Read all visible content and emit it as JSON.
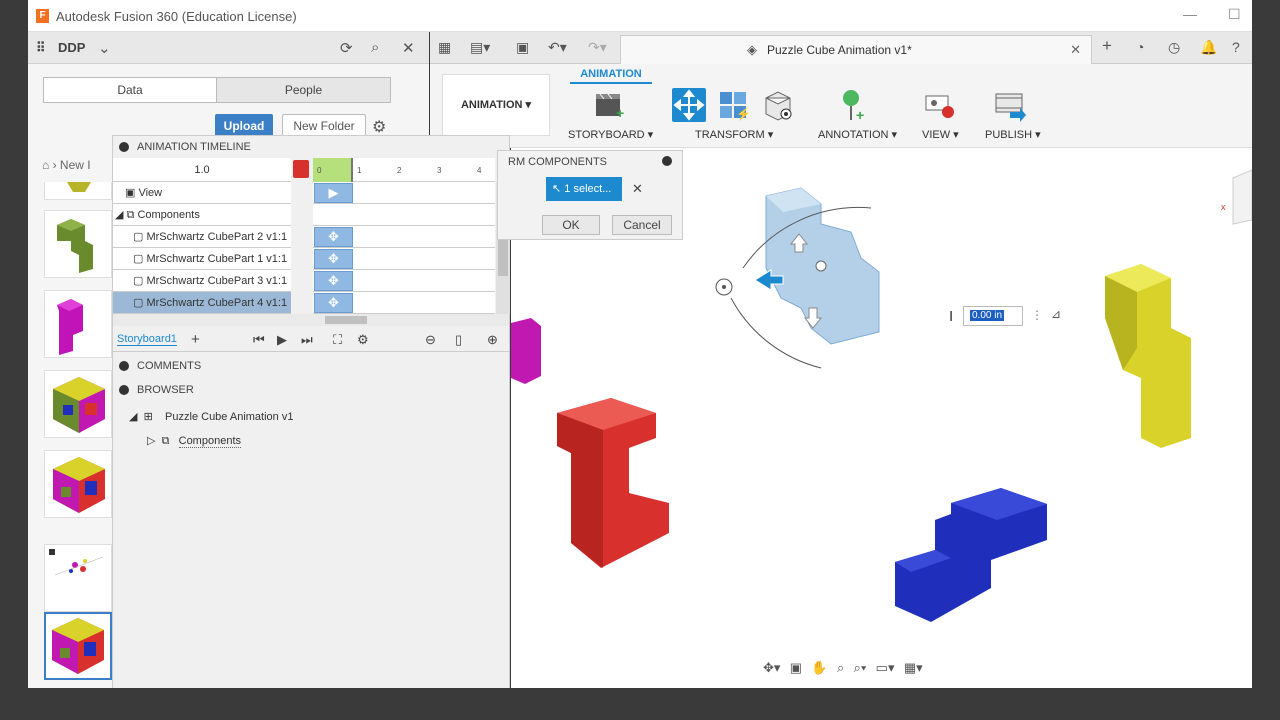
{
  "window": {
    "title": "Autodesk Fusion 360 (Education License)",
    "logo": "F"
  },
  "data_panel": {
    "team": "DDP",
    "tabs": [
      "Data",
      "People"
    ],
    "upload_label": "Upload",
    "new_folder_label": "New Folder",
    "breadcrumb": "New I"
  },
  "document": {
    "tab_label": "Puzzle Cube Animation v1*"
  },
  "ribbon": {
    "workspace": "ANIMATION",
    "tab": "ANIMATION",
    "groups": [
      {
        "label": "STORYBOARD ▾"
      },
      {
        "label": "TRANSFORM ▾"
      },
      {
        "label": "ANNOTATION ▾"
      },
      {
        "label": "VIEW ▾"
      },
      {
        "label": "PUBLISH ▾"
      }
    ]
  },
  "timeline": {
    "header": "ANIMATION TIMELINE",
    "time_value": "1.0",
    "ticks": [
      "0",
      "1",
      "2",
      "3",
      "4"
    ],
    "rows": [
      {
        "label": "View"
      },
      {
        "label": "Components"
      },
      {
        "label": "MrSchwartz CubePart 2 v1:1"
      },
      {
        "label": "MrSchwartz CubePart 1 v1:1"
      },
      {
        "label": "MrSchwartz CubePart 3 v1:1"
      },
      {
        "label": "MrSchwartz CubePart 4 v1:1"
      }
    ],
    "storyboard_tab": "Storyboard1"
  },
  "comments": {
    "header": "COMMENTS"
  },
  "browser": {
    "header": "BROWSER",
    "root": "Puzzle Cube Animation v1",
    "child": "Components"
  },
  "transform_dialog": {
    "title": "RM COMPONENTS",
    "selection": "1 select...",
    "ok_label": "OK",
    "cancel_label": "Cancel"
  },
  "value_input": {
    "value": "0.00 in"
  },
  "colors": {
    "accent": "#1d8ad0",
    "selection": "#9bb9d6",
    "red": "#d8302c",
    "blue": "#1f2fbb",
    "yellow": "#d8d22a"
  }
}
